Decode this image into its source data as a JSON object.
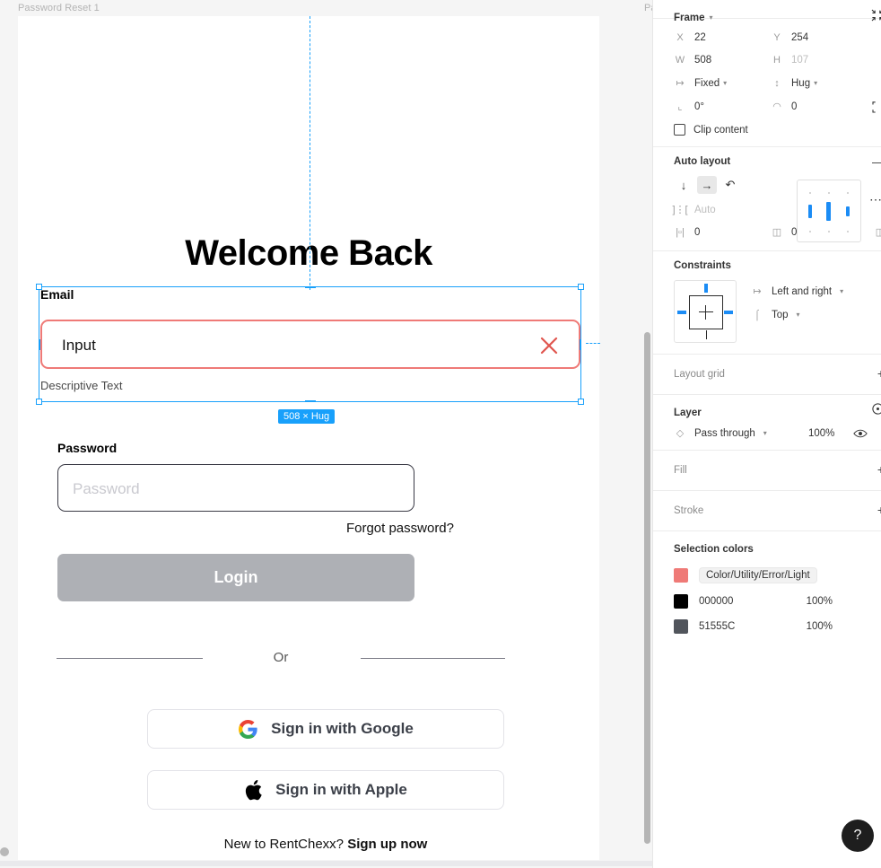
{
  "canvas": {
    "frame_label": "Password Reset 1",
    "next_frame_label": "Pa",
    "size_badge": "508 × Hug"
  },
  "design": {
    "heading": "Welcome Back",
    "email": {
      "label": "Email",
      "value": "Input",
      "description": "Descriptive Text",
      "clear_icon": "close-x-icon",
      "border_color": "#EF7A77"
    },
    "password": {
      "label": "Password",
      "placeholder": "Password"
    },
    "forgot_password": "Forgot password?",
    "login_button": "Login",
    "divider_text": "Or",
    "google_button": "Sign in with Google",
    "apple_button": "Sign in with Apple",
    "signup_prompt": "New to RentChexx?",
    "signup_link": "Sign up now"
  },
  "panel": {
    "frame": {
      "title": "Frame",
      "x_label": "X",
      "x_value": "22",
      "y_label": "Y",
      "y_value": "254",
      "w_label": "W",
      "w_value": "508",
      "h_label": "H",
      "h_value": "107",
      "resize_w": "Fixed",
      "resize_h": "Hug",
      "rotation": "0°",
      "corner_radius": "0",
      "clip_content": "Clip content"
    },
    "auto_layout": {
      "title": "Auto layout",
      "spacing_mode": "Auto",
      "horizontal_padding": "0",
      "vertical_padding": "0"
    },
    "constraints": {
      "title": "Constraints",
      "horizontal": "Left and right",
      "vertical": "Top"
    },
    "layout_grid": {
      "title": "Layout grid"
    },
    "layer": {
      "title": "Layer",
      "blend_mode": "Pass through",
      "opacity": "100%"
    },
    "fill": {
      "title": "Fill"
    },
    "stroke": {
      "title": "Stroke"
    },
    "selection_colors": {
      "title": "Selection colors",
      "items": [
        {
          "swatch": "#EF7A77",
          "name": "Color/Utility/Error/Light",
          "opacity": ""
        },
        {
          "swatch": "#000000",
          "name": "000000",
          "opacity": "100%"
        },
        {
          "swatch": "#51555C",
          "name": "51555C",
          "opacity": "100%"
        }
      ]
    },
    "help_label": "?"
  }
}
